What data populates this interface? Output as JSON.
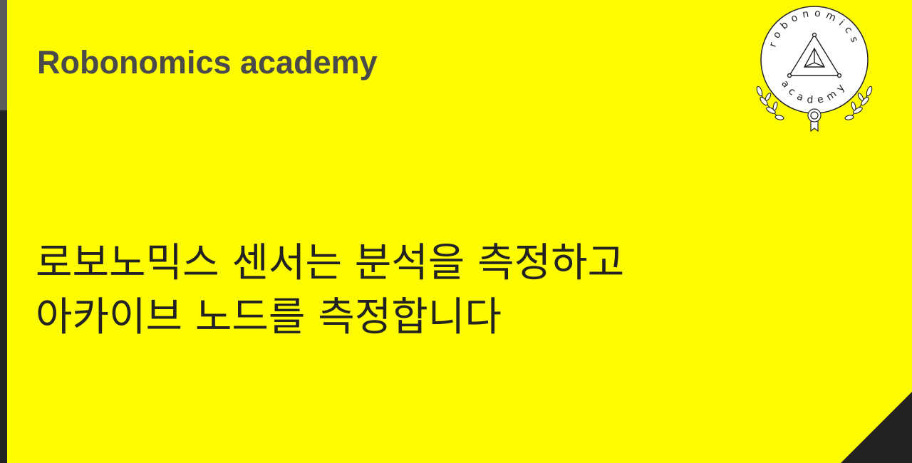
{
  "header": {
    "brand_title": "Robonomics academy"
  },
  "main": {
    "headline_line_1": "로보노믹스 센서는 분석을 측정하고",
    "headline_line_2": "아카이브 노드를 측정합니다"
  },
  "logo": {
    "ring_text_top": "robonomics",
    "ring_text_bottom": "academy",
    "icon": "robonomics-academy-emblem"
  },
  "colors": {
    "background": "#fffb00",
    "text_dark": "#222222",
    "brand_grey": "#4a4a4a",
    "bar_dark": "#222222",
    "bar_grey": "#5a5a5a"
  }
}
